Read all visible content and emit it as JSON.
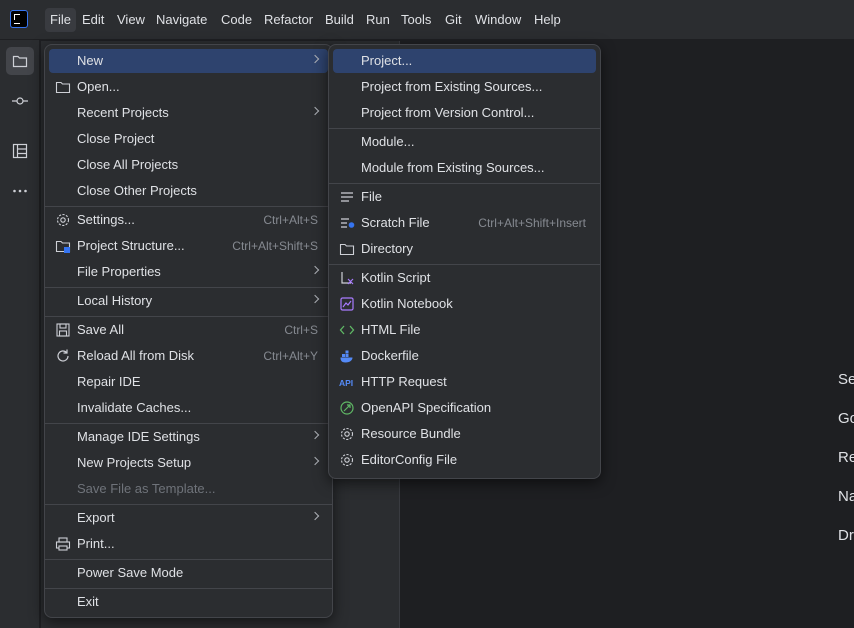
{
  "menubar": {
    "items": [
      {
        "label": "File",
        "active": true
      },
      {
        "label": "Edit"
      },
      {
        "label": "View"
      },
      {
        "label": "Navigate"
      },
      {
        "label": "Code"
      },
      {
        "label": "Refactor"
      },
      {
        "label": "Build"
      },
      {
        "label": "Run"
      },
      {
        "label": "Tools"
      },
      {
        "label": "Git"
      },
      {
        "label": "Window"
      },
      {
        "label": "Help"
      }
    ]
  },
  "toolstrip": {
    "buttons": [
      {
        "name": "folder-icon",
        "active": true
      },
      {
        "name": "commit-icon"
      },
      {
        "name": "structure-icon"
      },
      {
        "name": "more-icon"
      }
    ]
  },
  "file_menu": {
    "items": [
      {
        "label": "New",
        "submenu": true,
        "selected": true
      },
      {
        "label": "Open...",
        "icon": "folder-icon"
      },
      {
        "label": "Recent Projects",
        "submenu": true
      },
      {
        "label": "Close Project"
      },
      {
        "label": "Close All Projects"
      },
      {
        "label": "Close Other Projects",
        "sep_after": true
      },
      {
        "label": "Settings...",
        "icon": "gear-icon",
        "shortcut": "Ctrl+Alt+S"
      },
      {
        "label": "Project Structure...",
        "icon": "project-structure-icon",
        "shortcut": "Ctrl+Alt+Shift+S"
      },
      {
        "label": "File Properties",
        "submenu": true,
        "sep_after": true
      },
      {
        "label": "Local History",
        "submenu": true,
        "sep_after": true
      },
      {
        "label": "Save All",
        "icon": "save-icon",
        "shortcut": "Ctrl+S"
      },
      {
        "label": "Reload All from Disk",
        "icon": "reload-icon",
        "shortcut": "Ctrl+Alt+Y"
      },
      {
        "label": "Repair IDE"
      },
      {
        "label": "Invalidate Caches...",
        "sep_after": true
      },
      {
        "label": "Manage IDE Settings",
        "submenu": true
      },
      {
        "label": "New Projects Setup",
        "submenu": true
      },
      {
        "label": "Save File as Template...",
        "disabled": true,
        "sep_after": true
      },
      {
        "label": "Export",
        "submenu": true
      },
      {
        "label": "Print...",
        "icon": "print-icon",
        "sep_after": true
      },
      {
        "label": "Power Save Mode",
        "sep_after": true
      },
      {
        "label": "Exit"
      }
    ]
  },
  "new_menu": {
    "items": [
      {
        "label": "Project...",
        "selected": true
      },
      {
        "label": "Project from Existing Sources..."
      },
      {
        "label": "Project from Version Control...",
        "sep_after": true
      },
      {
        "label": "Module..."
      },
      {
        "label": "Module from Existing Sources...",
        "sep_after": true
      },
      {
        "label": "File",
        "icon": "file-icon"
      },
      {
        "label": "Scratch File",
        "icon": "scratch-file-icon",
        "shortcut": "Ctrl+Alt+Shift+Insert"
      },
      {
        "label": "Directory",
        "icon": "folder-icon",
        "sep_after": true
      },
      {
        "label": "Kotlin Script",
        "icon": "kotlin-script-icon"
      },
      {
        "label": "Kotlin Notebook",
        "icon": "kotlin-notebook-icon"
      },
      {
        "label": "HTML File",
        "icon": "html-icon"
      },
      {
        "label": "Dockerfile",
        "icon": "docker-icon"
      },
      {
        "label": "HTTP Request",
        "icon": "api-icon"
      },
      {
        "label": "OpenAPI Specification",
        "icon": "openapi-icon"
      },
      {
        "label": "Resource Bundle",
        "icon": "gear-icon"
      },
      {
        "label": "EditorConfig File",
        "icon": "gear-icon"
      }
    ]
  },
  "welcome_hints": [
    "Se",
    "Go",
    "Re",
    "Na",
    "Dr"
  ],
  "colors": {
    "selected_row": "#2e436e",
    "menu_bg": "#2b2d30",
    "accent": "#3574f0"
  }
}
